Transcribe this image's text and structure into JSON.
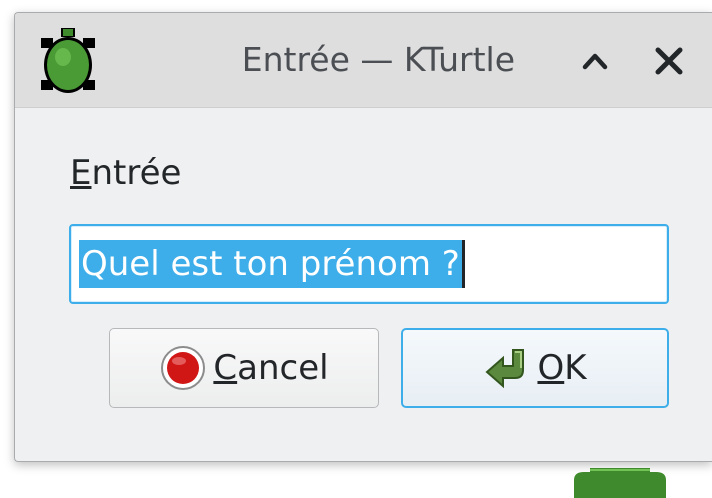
{
  "window": {
    "title": "Entrée — KTurtle",
    "app_icon": "turtle-icon",
    "controls": {
      "maximize": "chevron-up-icon",
      "close": "close-icon"
    }
  },
  "dialog": {
    "label_mnemonic": "E",
    "label_rest": "ntrée",
    "input": {
      "value": "Quel est ton prénom ?"
    },
    "cancel_button": {
      "mnemonic": "C",
      "rest": "ancel",
      "icon": "stop-icon"
    },
    "ok_button": {
      "mnemonic": "O",
      "rest": "K",
      "icon": "ok-arrow-icon"
    }
  },
  "colors": {
    "accent": "#3daee9",
    "titlebar": "#dedede",
    "window_bg": "#eff0f1",
    "turtle_green": "#3f8a2c",
    "stop_red": "#d11616"
  }
}
